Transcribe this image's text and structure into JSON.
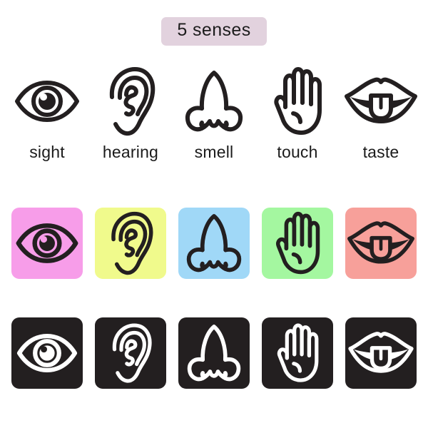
{
  "title": {
    "text": "5 senses",
    "pill_color": "#e2d2de",
    "text_color": "#1c1c1c"
  },
  "senses": [
    {
      "id": "sight",
      "label": "sight",
      "icon": "eye-icon",
      "tile_color": "#f79de9"
    },
    {
      "id": "hearing",
      "label": "hearing",
      "icon": "ear-icon",
      "tile_color": "#f0fa8c"
    },
    {
      "id": "smell",
      "label": "smell",
      "icon": "nose-icon",
      "tile_color": "#a0d8f7"
    },
    {
      "id": "touch",
      "label": "touch",
      "icon": "hand-icon",
      "tile_color": "#a4f7a0"
    },
    {
      "id": "taste",
      "label": "taste",
      "icon": "mouth-icon",
      "tile_color": "#f7a09a"
    }
  ],
  "rows": {
    "outline": {
      "stroke_color": "#231f20",
      "background": "#ffffff"
    },
    "colored": {
      "stroke_color": "#231f20"
    },
    "dark": {
      "stroke_color": "#ffffff",
      "background": "#231f20"
    }
  }
}
